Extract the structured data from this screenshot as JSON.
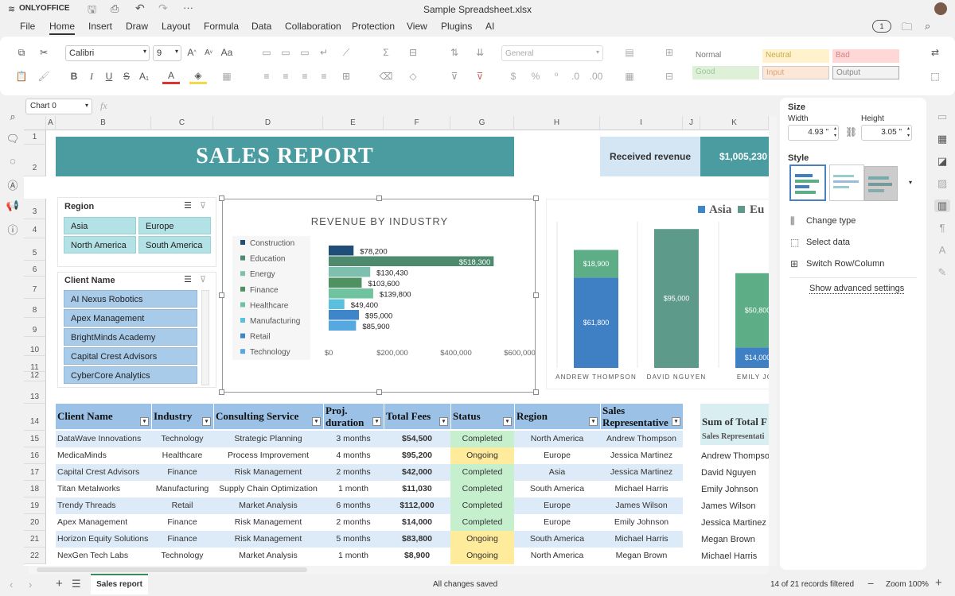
{
  "app": {
    "logo": "ONLYOFFICE",
    "doc_title": "Sample Spreadsheet.xlsx"
  },
  "menu": [
    "File",
    "Home",
    "Insert",
    "Draw",
    "Layout",
    "Formula",
    "Data",
    "Collaboration",
    "Protection",
    "View",
    "Plugins",
    "AI"
  ],
  "menu_active": "Home",
  "user_count": "1",
  "toolbar": {
    "font_name": "Calibri",
    "font_size": "9",
    "number_format": "General",
    "styles": [
      {
        "label": "Normal",
        "bg": "#ffffff",
        "color": "#777777"
      },
      {
        "label": "Neutral",
        "bg": "#fff2cc",
        "color": "#c9a94a"
      },
      {
        "label": "Bad",
        "bg": "#ffd7d7",
        "color": "#d98080"
      },
      {
        "label": "Good",
        "bg": "#dff0d8",
        "color": "#9cc59c"
      },
      {
        "label": "Input",
        "bg": "#fde7d6",
        "color": "#d9a37a"
      },
      {
        "label": "Output",
        "bg": "#f2f2f2",
        "color": "#888888"
      }
    ]
  },
  "formula": {
    "name_box": "Chart 0",
    "fx": "fx"
  },
  "columns": [
    "A",
    "B",
    "C",
    "D",
    "E",
    "F",
    "G",
    "H",
    "I",
    "J",
    "K"
  ],
  "rows": [
    "1",
    "2",
    "3",
    "4",
    "5",
    "6",
    "7",
    "8",
    "9",
    "10",
    "11",
    "12",
    "13",
    "14",
    "15",
    "16",
    "17",
    "18",
    "19",
    "20",
    "21",
    "22"
  ],
  "banner": {
    "title": "SALES REPORT",
    "received_label": "Received revenue",
    "received_value": "$1,005,230"
  },
  "region_slicer": {
    "title": "Region",
    "items": [
      "Asia",
      "Europe",
      "North America",
      "South America"
    ]
  },
  "client_slicer": {
    "title": "Client Name",
    "items": [
      "AI Nexus Robotics",
      "Apex Management",
      "BrightMinds Academy",
      "Capital Crest Advisors",
      "CyberCore Analytics"
    ]
  },
  "chart_data": [
    {
      "type": "bar",
      "title": "REVENUE BY INDUSTRY",
      "orientation": "horizontal",
      "categories": [
        "Construction",
        "Education",
        "Energy",
        "Finance",
        "Healthcare",
        "Manufacturing",
        "Retail",
        "Technology"
      ],
      "values": [
        78200,
        518300,
        130430,
        103600,
        139800,
        49400,
        95000,
        85900
      ],
      "value_labels": [
        "$78,200",
        "$518,300",
        "$130,430",
        "$103,600",
        "$139,800",
        "$49,400",
        "$95,000",
        "$85,900"
      ],
      "colors": [
        "#1f4e79",
        "#4e8a6e",
        "#7fbfb0",
        "#4f9160",
        "#6fc39f",
        "#5bc0de",
        "#3f86c9",
        "#55a8e0"
      ],
      "xticks": [
        "$0",
        "$200,000",
        "$400,000",
        "$600,000"
      ],
      "xlim": [
        0,
        600000
      ]
    },
    {
      "type": "bar",
      "stacked": true,
      "legend": [
        "Asia",
        "Eu"
      ],
      "legend_colors": [
        "#3f86c9",
        "#5e9a8a"
      ],
      "categories": [
        "ANDREW THOMPSON",
        "DAVID NGUYEN",
        "EMILY JOH"
      ],
      "series": [
        {
          "values": [
            61800,
            0,
            14000
          ],
          "labels": [
            "$61,800",
            "",
            "$14,000"
          ],
          "color": "#3f7fc3"
        },
        {
          "values": [
            18900,
            95000,
            50800
          ],
          "labels": [
            "$18,900",
            "$95,000",
            "$50,800"
          ],
          "color": "#5dae86"
        }
      ]
    }
  ],
  "table": {
    "headers": [
      "Client Name",
      "Industry",
      "Consulting Service",
      "Proj. duration",
      "Total Fees",
      "Status",
      "Region",
      "Sales Representative"
    ],
    "rows": [
      [
        "DataWave Innovations",
        "Technology",
        "Strategic Planning",
        "3 months",
        "$54,500",
        "Completed",
        "North America",
        "Andrew Thompson"
      ],
      [
        "MedicaMinds",
        "Healthcare",
        "Process Improvement",
        "4 months",
        "$95,200",
        "Ongoing",
        "Europe",
        "Jessica Martinez"
      ],
      [
        "Capital Crest Advisors",
        "Finance",
        "Risk Management",
        "2 months",
        "$42,000",
        "Completed",
        "Asia",
        "Jessica Martinez"
      ],
      [
        "Titan Metalworks",
        "Manufacturing",
        "Supply Chain Optimization",
        "1 month",
        "$11,030",
        "Completed",
        "South America",
        "Michael Harris"
      ],
      [
        "Trendy Threads",
        "Retail",
        "Market Analysis",
        "6 months",
        "$112,000",
        "Completed",
        "Europe",
        "James Wilson"
      ],
      [
        "Apex Management",
        "Finance",
        "Risk Management",
        "2 months",
        "$14,000",
        "Completed",
        "Europe",
        "Emily Johnson"
      ],
      [
        "Horizon Equity Solutions",
        "Finance",
        "Risk Management",
        "5 months",
        "$83,800",
        "Ongoing",
        "South America",
        "Michael Harris"
      ],
      [
        "NexGen Tech Labs",
        "Technology",
        "Market Analysis",
        "1 month",
        "$8,900",
        "Ongoing",
        "North America",
        "Megan Brown"
      ]
    ],
    "status_colors": {
      "Completed": "#c6efce",
      "Ongoing": "#ffeb9c"
    }
  },
  "pivot": {
    "title": "Sum of Total F",
    "subheader": "Sales Representati",
    "names": [
      "Andrew Thompso",
      "David Nguyen",
      "Emily Johnson",
      "James Wilson",
      "Jessica Martinez",
      "Megan Brown",
      "Michael Harris"
    ]
  },
  "panel": {
    "size_label": "Size",
    "width_label": "Width",
    "height_label": "Height",
    "width_value": "4.93 \"",
    "height_value": "3.05 \"",
    "style_label": "Style",
    "change_type": "Change type",
    "select_data": "Select data",
    "switch_row_col": "Switch Row/Column",
    "advanced": "Show advanced settings"
  },
  "status": {
    "sheet_tab": "Sales report",
    "save_state": "All changes saved",
    "filter_info": "14 of 21 records filtered",
    "zoom": "Zoom 100%"
  }
}
